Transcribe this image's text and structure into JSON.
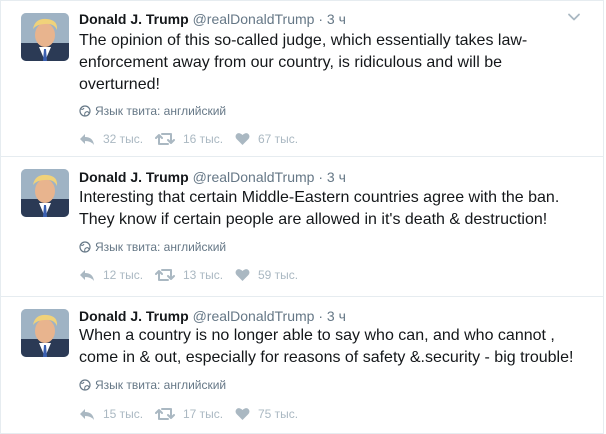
{
  "tweets": [
    {
      "fullname": "Donald J. Trump",
      "username": "@realDonaldTrump",
      "separator": "·",
      "time": "3 ч",
      "text": "The opinion of this so-called judge, which essentially takes law-enforcement away from our country, is ridiculous and will be overturned!",
      "language": "Язык твита: английский",
      "replies": "32 тыс.",
      "retweets": "16 тыс.",
      "likes": "67 тыс."
    },
    {
      "fullname": "Donald J. Trump",
      "username": "@realDonaldTrump",
      "separator": "·",
      "time": "3 ч",
      "text": "Interesting that certain Middle-Eastern countries agree with the ban. They know if certain people are allowed in it's death & destruction!",
      "language": "Язык твита: английский",
      "replies": "12 тыс.",
      "retweets": "13 тыс.",
      "likes": "59 тыс."
    },
    {
      "fullname": "Donald J. Trump",
      "username": "@realDonaldTrump",
      "separator": "·",
      "time": "3 ч",
      "text": "When a country is no longer able to say who can, and who cannot , come in & out, especially for reasons of safety &.security - big trouble!",
      "language": "Язык твита: английский",
      "replies": "15 тыс.",
      "retweets": "17 тыс.",
      "likes": "75 тыс."
    }
  ],
  "icons": {
    "caret": "chevron-down-icon",
    "globe": "globe-icon",
    "reply": "reply-icon",
    "retweet": "retweet-icon",
    "like": "heart-icon"
  },
  "colors": {
    "name": "#14171a",
    "meta": "#657786",
    "action": "#aab8c2",
    "border": "#e6ecf0"
  }
}
